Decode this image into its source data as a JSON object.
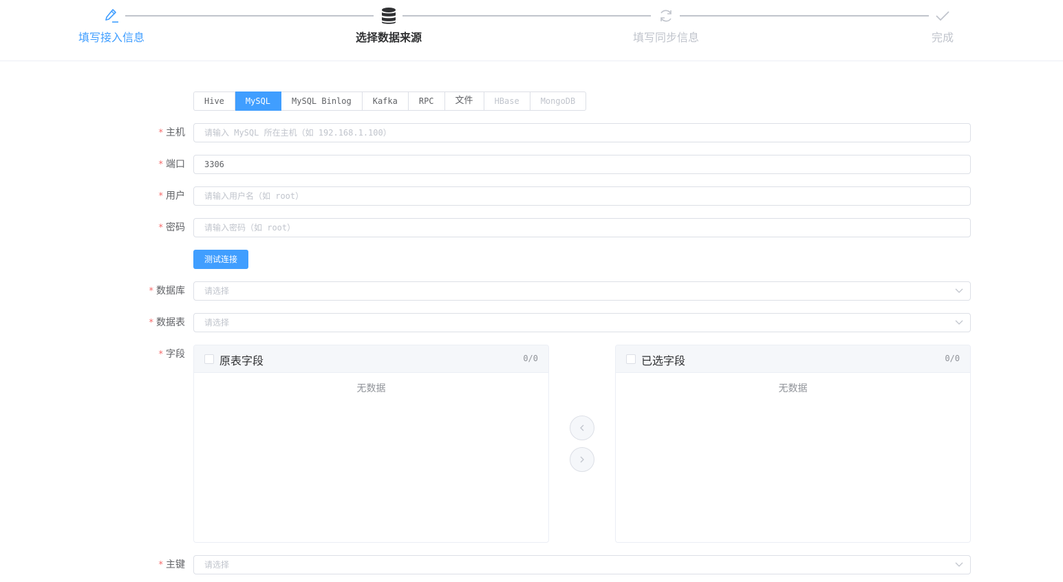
{
  "steps": [
    {
      "label": "填写接入信息",
      "icon": "edit-icon",
      "state": "done"
    },
    {
      "label": "选择数据来源",
      "icon": "database-icon",
      "state": "active"
    },
    {
      "label": "填写同步信息",
      "icon": "refresh-icon",
      "state": "wait"
    },
    {
      "label": "完成",
      "icon": "check-icon",
      "state": "wait"
    }
  ],
  "source_tabs": [
    {
      "label": "Hive"
    },
    {
      "label": "MySQL",
      "selected": true
    },
    {
      "label": "MySQL Binlog"
    },
    {
      "label": "Kafka"
    },
    {
      "label": "RPC"
    },
    {
      "label": "文件"
    },
    {
      "label": "HBase",
      "disabled": true
    },
    {
      "label": "MongoDB",
      "disabled": true
    }
  ],
  "form": {
    "host": {
      "label": "主机",
      "value": "",
      "placeholder": "请输入 MySQL 所在主机（如 192.168.1.100）"
    },
    "port": {
      "label": "端口",
      "value": "3306",
      "placeholder": ""
    },
    "user": {
      "label": "用户",
      "value": "",
      "placeholder": "请输入用户名（如 root）"
    },
    "password": {
      "label": "密码",
      "value": "",
      "placeholder": "请输入密码（如 root）"
    },
    "test_button": "测试连接",
    "database": {
      "label": "数据库",
      "placeholder": "请选择"
    },
    "table": {
      "label": "数据表",
      "placeholder": "请选择"
    },
    "fields": {
      "label": "字段",
      "source_title": "原表字段",
      "source_count": "0/0",
      "target_title": "已选字段",
      "target_count": "0/0",
      "empty_text": "无数据"
    },
    "primary_key": {
      "label": "主键",
      "placeholder": "请选择"
    }
  },
  "colors": {
    "primary": "#409eff",
    "required": "#f56c6c",
    "disabled": "#c0c4cc"
  }
}
